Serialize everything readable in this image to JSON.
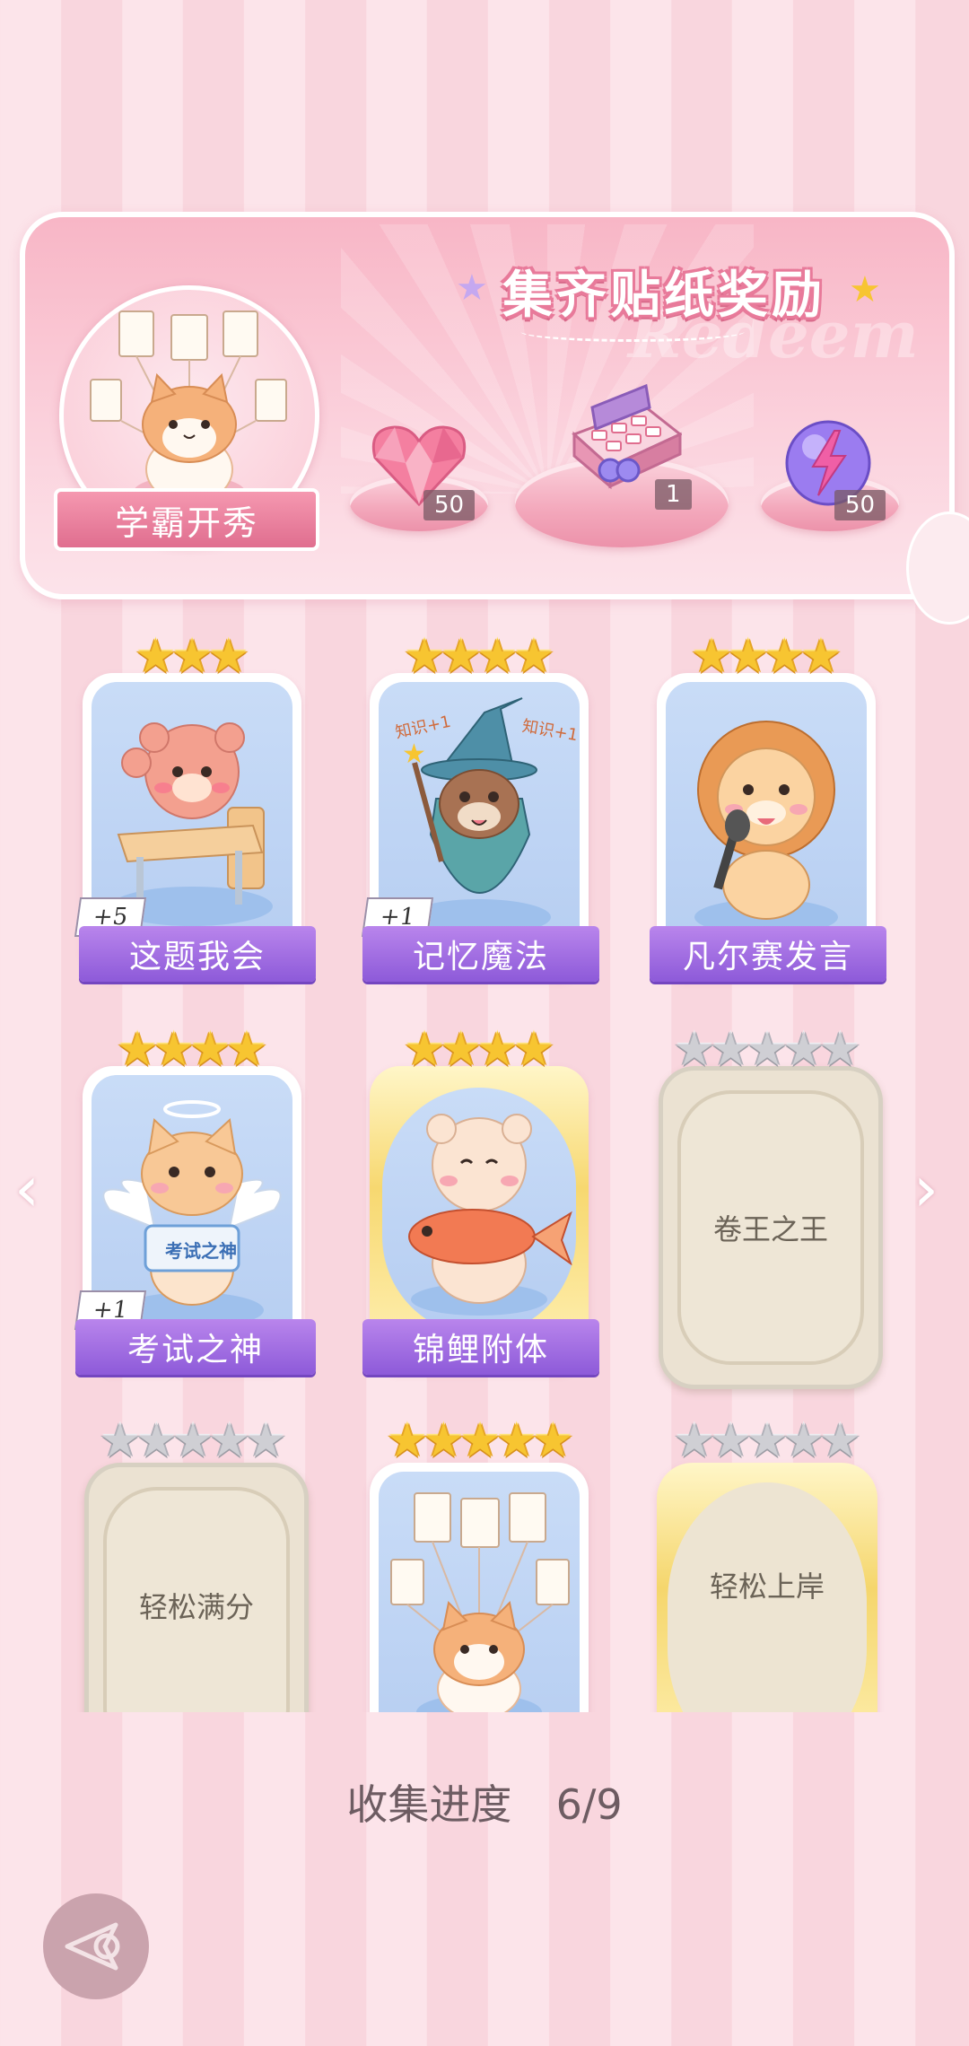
{
  "banner": {
    "title": "集齐贴纸奖励",
    "watermark": "Redeem",
    "badge_label": "学霸开秀",
    "rewards": [
      {
        "icon": "pink-diamond-heart-icon",
        "count": "50"
      },
      {
        "icon": "gift-box-icon",
        "count": "1"
      },
      {
        "icon": "lightning-orb-icon",
        "count": "50"
      }
    ]
  },
  "stickers": [
    {
      "name": "这题我会",
      "stars": 3,
      "star_style": "gold",
      "bonus": "+5",
      "state": "collected",
      "art": "bear-at-desk"
    },
    {
      "name": "记忆魔法",
      "stars": 4,
      "star_style": "gold",
      "bonus": "+1",
      "state": "collected",
      "art": "otter-wizard",
      "art_text": [
        "知识+1",
        "知识+1"
      ]
    },
    {
      "name": "凡尔赛发言",
      "stars": 4,
      "star_style": "gold",
      "bonus": "",
      "state": "collected",
      "art": "lion-microphone"
    },
    {
      "name": "考试之神",
      "stars": 4,
      "star_style": "gold",
      "bonus": "+1",
      "state": "collected",
      "art": "angel-cat",
      "art_text": [
        "考试之神"
      ]
    },
    {
      "name": "锦鲤附体",
      "stars": 4,
      "star_style": "gold",
      "bonus": "",
      "state": "collected-gold",
      "art": "bear-koi"
    },
    {
      "name": "卷王之王",
      "stars": 5,
      "star_style": "gray",
      "bonus": "",
      "state": "locked"
    },
    {
      "name": "轻松满分",
      "stars": 5,
      "star_style": "gray",
      "bonus": "",
      "state": "locked"
    },
    {
      "name": "",
      "stars": 5,
      "star_style": "gold",
      "bonus": "",
      "state": "collected",
      "art": "cat-with-papers"
    },
    {
      "name": "轻松上岸",
      "stars": 5,
      "star_style": "gray",
      "bonus": "",
      "state": "locked-gold"
    }
  ],
  "progress": {
    "label": "收集进度",
    "value": "6/9"
  },
  "nav": {
    "prev_icon": "chevron-left-icon",
    "next_icon": "chevron-right-icon",
    "back_icon": "back-arrow-icon"
  },
  "colors": {
    "ribbon": "#9a66de",
    "accent_pink": "#f598b0",
    "star_gold": "#f7c531"
  }
}
